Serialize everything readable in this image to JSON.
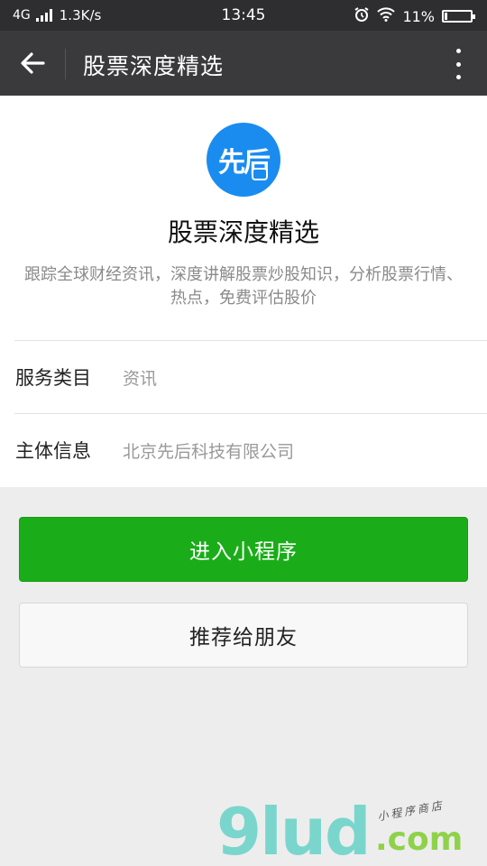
{
  "status_bar": {
    "network": "4G",
    "speed": "1.3K/s",
    "time": "13:45",
    "battery": "11%",
    "battery_level": 0.11
  },
  "app_bar": {
    "title": "股票深度精选",
    "back_icon": "arrow-left-icon",
    "more_icon": "more-vertical-icon"
  },
  "mini_program": {
    "logo_text": "先后",
    "name": "股票深度精选",
    "description": "跟踪全球财经资讯，深度讲解股票炒股知识，分析股票行情、热点，免费评估股价",
    "logo_color": "#1a8cf0"
  },
  "info_rows": [
    {
      "label": "服务类目",
      "value": "资讯"
    },
    {
      "label": "主体信息",
      "value": "北京先后科技有限公司"
    }
  ],
  "actions": {
    "enter": "进入小程序",
    "recommend": "推荐给朋友",
    "primary_color": "#1aad19"
  },
  "watermark": {
    "brand": "9lud",
    "domain": ".com",
    "tagline": "小程序商店"
  }
}
